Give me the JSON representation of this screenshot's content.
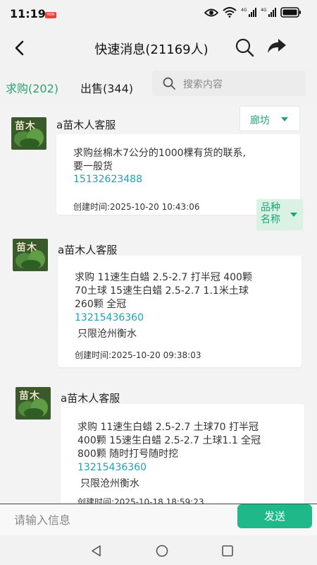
{
  "status_bar": {
    "time": "11:19",
    "hdr": "HDR",
    "signal1": "4G",
    "signal2": "4G"
  },
  "nav": {
    "title": "快速消息(21169人)"
  },
  "tabs": {
    "buy": "求购(202)",
    "sell": "出售(344)"
  },
  "search": {
    "placeholder": "搜索内容"
  },
  "filters": {
    "region": "廊坊",
    "variety": "品种名称"
  },
  "messages": [
    {
      "avatar_text": "苗木",
      "sender": "a苗木人客服",
      "lines": [
        "求购丝棉木7公分的1000棵有货的联系,",
        "要一般货"
      ],
      "phone": "15132623488",
      "note": "",
      "created": "创建时间:2025-10-20 10:43:06"
    },
    {
      "avatar_text": "苗木",
      "sender": "a苗木人客服",
      "lines": [
        "求购 11速生白蜡 2.5-2.7 打半冠 400颗",
        "70土球 15速生白蜡 2.5-2.7 1.1米土球",
        "260颗 全冠"
      ],
      "phone": "13215436360",
      "note": "只限沧州衡水",
      "created": "创建时间:2025-10-20 09:38:03"
    },
    {
      "avatar_text": "苗木",
      "sender": "a苗木人客服",
      "lines": [
        "求购 11速生白蜡 2.5-2.7 土球70 打半冠",
        "400颗 15速生白蜡 2.5-2.7 土球1.1 全冠",
        "800颗 随时打号随时挖"
      ],
      "phone": "13215436360",
      "note": "只限沧州衡水",
      "created": "创建时间:2025-10-18 18:59:23"
    }
  ],
  "composer": {
    "placeholder": "请输入信息",
    "send": "发送"
  },
  "colors": {
    "accent": "#1fb989",
    "phone": "#1aa2b7",
    "tab_active": "#2aa374"
  }
}
